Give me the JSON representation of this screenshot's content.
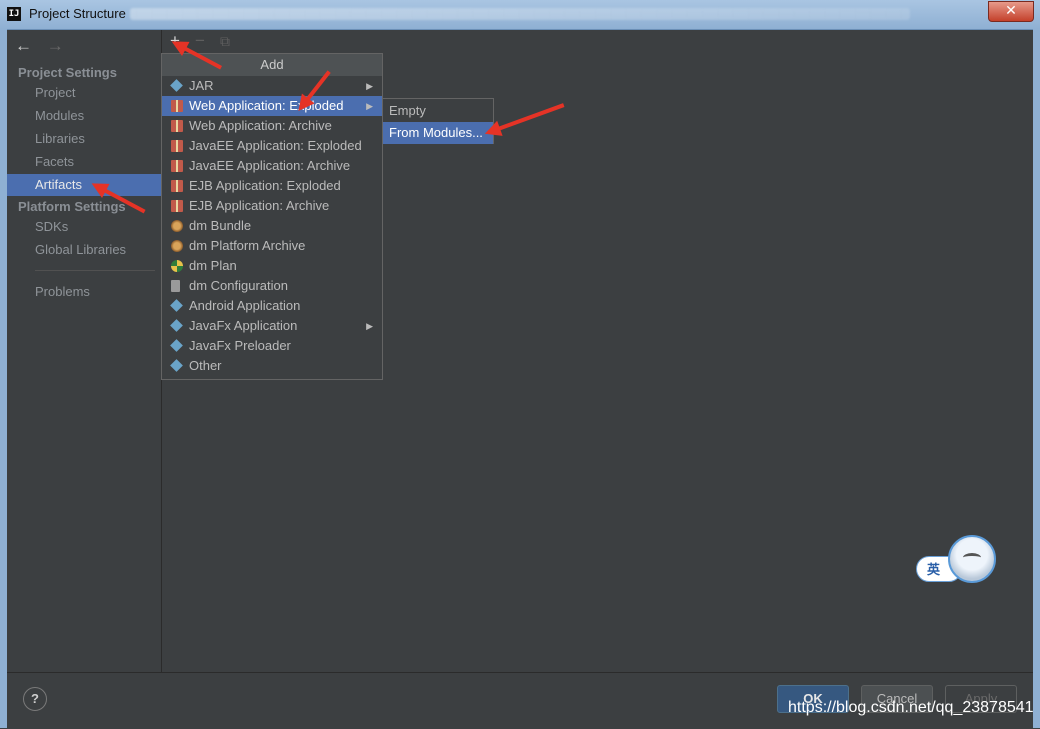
{
  "window": {
    "title": "Project Structure",
    "close_glyph": "✕",
    "app_icon_text": "IJ"
  },
  "nav": {
    "back_glyph": "←",
    "forward_glyph": "→",
    "project_settings_header": "Project Settings",
    "project_settings_items": [
      "Project",
      "Modules",
      "Libraries",
      "Facets",
      "Artifacts"
    ],
    "platform_settings_header": "Platform Settings",
    "platform_settings_items": [
      "SDKs",
      "Global Libraries"
    ],
    "problems_label": "Problems",
    "selected": "Artifacts"
  },
  "toolbar": {
    "add_glyph": "+",
    "remove_glyph": "−",
    "copy_glyph": "⧉"
  },
  "add_menu": {
    "title": "Add",
    "items": [
      {
        "label": "JAR",
        "icon": "diamond-icon",
        "submenu": true
      },
      {
        "label": "Web Application: Exploded",
        "icon": "gift-icon",
        "submenu": true,
        "selected": true
      },
      {
        "label": "Web Application: Archive",
        "icon": "gift-icon"
      },
      {
        "label": "JavaEE Application: Exploded",
        "icon": "gift-icon"
      },
      {
        "label": "JavaEE Application: Archive",
        "icon": "gift-icon"
      },
      {
        "label": "EJB Application: Exploded",
        "icon": "gift-icon"
      },
      {
        "label": "EJB Application: Archive",
        "icon": "gift-icon"
      },
      {
        "label": "dm Bundle",
        "icon": "bundle-icon"
      },
      {
        "label": "dm Platform Archive",
        "icon": "bundle-icon"
      },
      {
        "label": "dm Plan",
        "icon": "plan-icon"
      },
      {
        "label": "dm Configuration",
        "icon": "config-icon"
      },
      {
        "label": "Android Application",
        "icon": "diamond-icon"
      },
      {
        "label": "JavaFx Application",
        "icon": "diamond-icon",
        "submenu": true
      },
      {
        "label": "JavaFx Preloader",
        "icon": "diamond-icon"
      },
      {
        "label": "Other",
        "icon": "diamond-icon"
      }
    ],
    "submenu_arrow": "▶"
  },
  "submenu": {
    "items": [
      "Empty",
      "From Modules..."
    ],
    "selected": "From Modules..."
  },
  "buttons": {
    "help": "?",
    "ok": "OK",
    "cancel": "Cancel",
    "apply": "Apply"
  },
  "ime": {
    "label": "英"
  },
  "watermark": "https://blog.csdn.net/qq_23878541",
  "colors": {
    "background": "#3c3f41",
    "selection": "#4b6eaf",
    "annotation": "#e53326",
    "ok_button": "#365880"
  }
}
